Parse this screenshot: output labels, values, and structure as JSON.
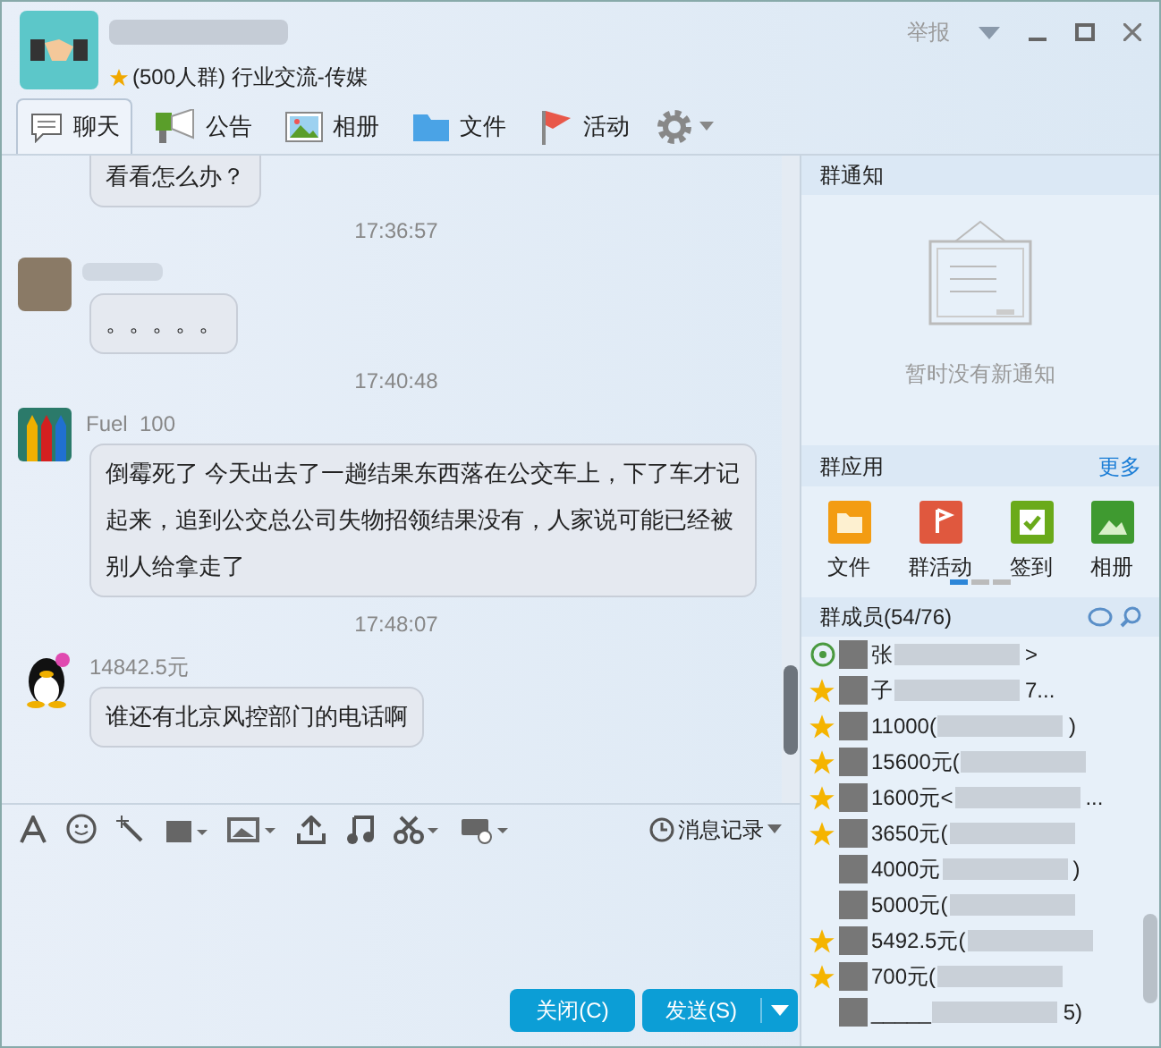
{
  "header": {
    "group_info": "(500人群) 行业交流-传媒",
    "report": "举报"
  },
  "tabs": [
    {
      "label": "聊天",
      "selected": true
    },
    {
      "label": "公告",
      "selected": false
    },
    {
      "label": "相册",
      "selected": false
    },
    {
      "label": "文件",
      "selected": false
    },
    {
      "label": "活动",
      "selected": false
    }
  ],
  "messages": [
    {
      "kind": "bubble",
      "text": "看看怎么办？",
      "cut_top": true
    },
    {
      "kind": "time",
      "text": "17:36:57"
    },
    {
      "kind": "sender"
    },
    {
      "kind": "bubble",
      "text": "。。。。。"
    },
    {
      "kind": "time",
      "text": "17:40:48"
    },
    {
      "kind": "sender",
      "name": "Fuel  100"
    },
    {
      "kind": "bubble",
      "text": "倒霉死了 今天出去了一趟结果东西落在公交车上，下了车才记起来，追到公交总公司失物招领结果没有，人家说可能已经被别人给拿走了"
    },
    {
      "kind": "time",
      "text": "17:48:07"
    },
    {
      "kind": "sender",
      "name": "14842.5元"
    },
    {
      "kind": "bubble",
      "text": "谁还有北京风控部门的电话啊"
    }
  ],
  "toolbar": {
    "history": "消息记录"
  },
  "buttons": {
    "close": "关闭(C)",
    "send": "发送(S)"
  },
  "notice": {
    "title": "群通知",
    "empty": "暂时没有新通知"
  },
  "apps": {
    "title": "群应用",
    "more": "更多",
    "items": [
      {
        "label": "文件"
      },
      {
        "label": "群活动"
      },
      {
        "label": "签到"
      },
      {
        "label": "相册"
      }
    ]
  },
  "members": {
    "title": "群成员(54/76)",
    "items": [
      {
        "text": "张",
        "suffix": ">",
        "kind": "online"
      },
      {
        "text": "子",
        "suffix": "7...",
        "kind": "star"
      },
      {
        "text": "11000(",
        "suffix": ")",
        "kind": "star"
      },
      {
        "text": "15600元(",
        "kind": "star"
      },
      {
        "text": "1600元<",
        "suffix": "...",
        "kind": "star"
      },
      {
        "text": "3650元(",
        "kind": "star"
      },
      {
        "text": "4000元",
        "suffix": ")",
        "kind": "plain"
      },
      {
        "text": "5000元(",
        "kind": "plain"
      },
      {
        "text": "5492.5元(",
        "kind": "star"
      },
      {
        "text": "700元(",
        "kind": "star"
      },
      {
        "text": "_____",
        "suffix": "5)",
        "kind": "plain"
      }
    ]
  }
}
